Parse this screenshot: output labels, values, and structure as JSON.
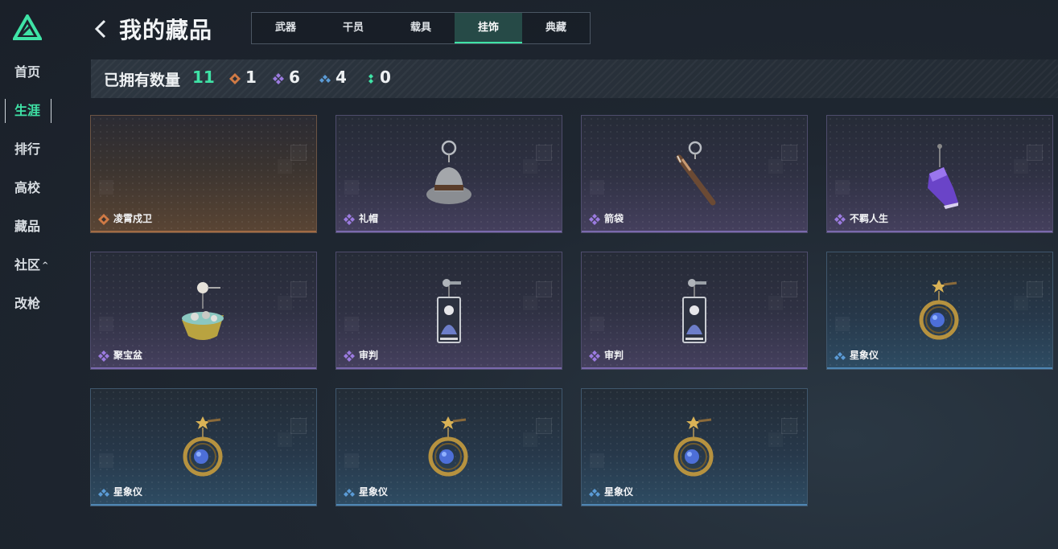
{
  "sidebar": {
    "items": [
      {
        "label": "首页"
      },
      {
        "label": "生涯"
      },
      {
        "label": "排行"
      },
      {
        "label": "高校"
      },
      {
        "label": "藏品"
      },
      {
        "label": "社区"
      },
      {
        "label": "改枪"
      }
    ],
    "active": "生涯",
    "accent": "#3fe3a6"
  },
  "header": {
    "title": "我的藏品",
    "tabs": [
      {
        "label": "武器"
      },
      {
        "label": "干员"
      },
      {
        "label": "载具"
      },
      {
        "label": "挂饰"
      },
      {
        "label": "典藏"
      }
    ],
    "active_tab": "挂饰"
  },
  "stats": {
    "label": "已拥有数量",
    "total": "11",
    "orange": "1",
    "purple": "6",
    "blue": "4",
    "green": "0"
  },
  "cards": [
    {
      "name": "凌霄戍卫",
      "rarity": "orange",
      "icon": "empty"
    },
    {
      "name": "礼帽",
      "rarity": "purple",
      "icon": "hat-icon"
    },
    {
      "name": "箭袋",
      "rarity": "purple",
      "icon": "quiver-icon"
    },
    {
      "name": "不羁人生",
      "rarity": "purple",
      "icon": "sneaker-icon"
    },
    {
      "name": "聚宝盆",
      "rarity": "purple",
      "icon": "treasure-bowl-icon"
    },
    {
      "name": "审判",
      "rarity": "purple",
      "icon": "judgement-card-icon"
    },
    {
      "name": "审判",
      "rarity": "purple",
      "icon": "judgement-card-icon"
    },
    {
      "name": "星象仪",
      "rarity": "blue",
      "icon": "astrolabe-icon"
    },
    {
      "name": "星象仪",
      "rarity": "blue",
      "icon": "astrolabe-icon"
    },
    {
      "name": "星象仪",
      "rarity": "blue",
      "icon": "astrolabe-icon"
    },
    {
      "name": "星象仪",
      "rarity": "blue",
      "icon": "astrolabe-icon"
    }
  ],
  "colors": {
    "orange": "#d07a45",
    "purple": "#9b7be0",
    "blue": "#5b9bd6",
    "green": "#3fe3a6"
  }
}
